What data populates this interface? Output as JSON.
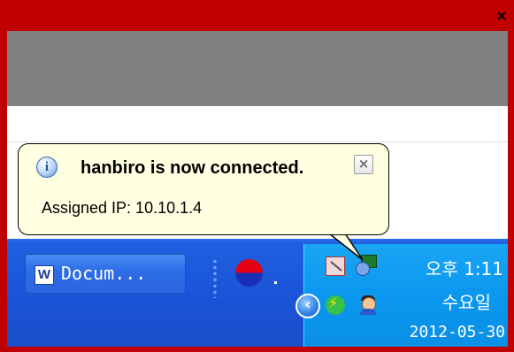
{
  "window": {
    "close_glyph": "×"
  },
  "taskbar": {
    "task_button": {
      "icon_letter": "W",
      "label": "Docum..."
    }
  },
  "tray": {
    "chevron_glyph": "‹",
    "clock": {
      "time": "오후 1:11",
      "day": "수요일",
      "date": "2012-05-30"
    }
  },
  "balloon": {
    "info_glyph": "i",
    "title": "hanbiro is now connected.",
    "body": "Assigned IP: 10.10.1.4",
    "close_glyph": "×"
  },
  "colors": {
    "frame": "#c00000",
    "taskbar": "#1f5fe0",
    "tray": "#0b97ee",
    "balloon": "#ffffe1"
  }
}
